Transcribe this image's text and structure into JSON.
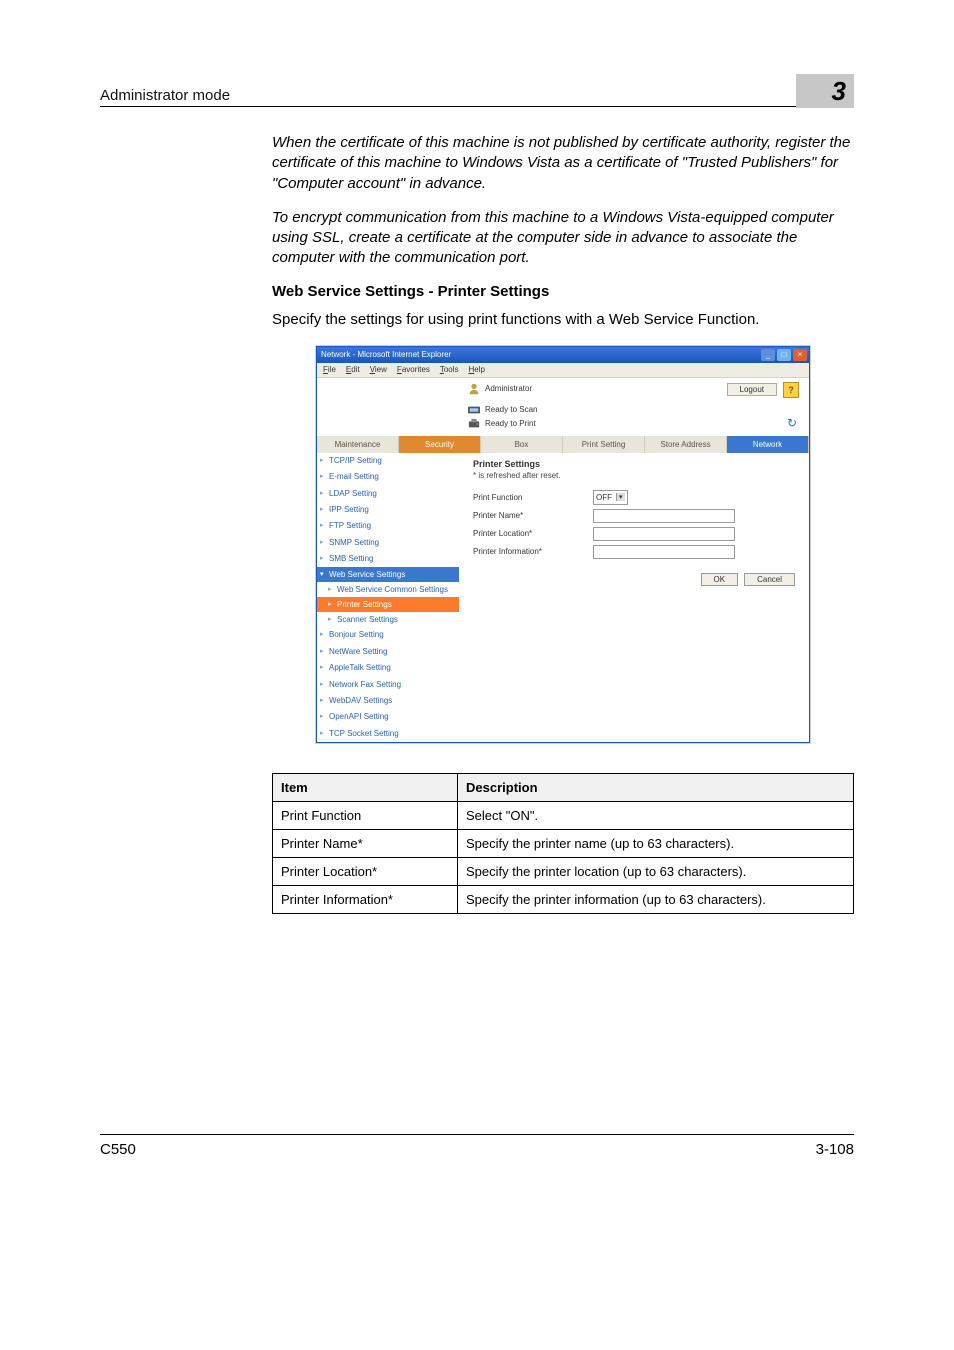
{
  "header": {
    "section": "Administrator mode",
    "chapter_num": "3"
  },
  "paragraphs": {
    "p1": "When the certificate of this machine is not published by certificate authority, register the certificate of this machine to Windows Vista as a certificate of \"Trusted Publishers\" for \"Computer account\" in advance.",
    "p2": "To encrypt communication from this machine to a Windows Vista-equipped computer using SSL, create a certificate at the computer side in advance to associate the computer with the communication port.",
    "heading": "Web Service Settings - Printer Settings",
    "p3": "Specify the settings for using print functions with a Web Service Function."
  },
  "screenshot": {
    "title": "Network - Microsoft Internet Explorer",
    "menu": [
      "File",
      "Edit",
      "View",
      "Favorites",
      "Tools",
      "Help"
    ],
    "administrator": "Administrator",
    "logout": "Logout",
    "status_scan": "Ready to Scan",
    "status_print": "Ready to Print",
    "tabs": [
      "Maintenance",
      "Security",
      "Box",
      "Print Setting",
      "Store Address",
      "Network"
    ],
    "side_items_top": [
      "TCP/IP Setting",
      "E-mail Setting",
      "LDAP Setting",
      "IPP Setting",
      "FTP Setting",
      "SNMP Setting",
      "SMB Setting"
    ],
    "side_group": "Web Service Settings",
    "side_subs": [
      "Web Service Common Settings",
      "Printer Settings",
      "Scanner Settings"
    ],
    "side_items_bottom": [
      "Bonjour Setting",
      "NetWare Setting",
      "AppleTalk Setting",
      "Network Fax Setting",
      "WebDAV Settings",
      "OpenAPI Setting",
      "TCP Socket Setting"
    ],
    "content_title": "Printer Settings",
    "content_note": "* is refreshed after reset.",
    "form": {
      "print_function_label": "Print Function",
      "print_function_value": "OFF",
      "printer_name_label": "Printer Name*",
      "printer_location_label": "Printer Location*",
      "printer_info_label": "Printer Information*"
    },
    "buttons": {
      "ok": "OK",
      "cancel": "Cancel"
    }
  },
  "table": {
    "head_item": "Item",
    "head_desc": "Description",
    "rows": [
      {
        "item": "Print Function",
        "desc": "Select \"ON\"."
      },
      {
        "item": "Printer Name*",
        "desc": "Specify the printer name (up to 63 characters)."
      },
      {
        "item": "Printer Location*",
        "desc": "Specify the printer location (up to 63 characters)."
      },
      {
        "item": "Printer Information*",
        "desc": "Specify the printer information (up to 63 characters)."
      }
    ]
  },
  "footer": {
    "model": "C550",
    "page": "3-108"
  }
}
